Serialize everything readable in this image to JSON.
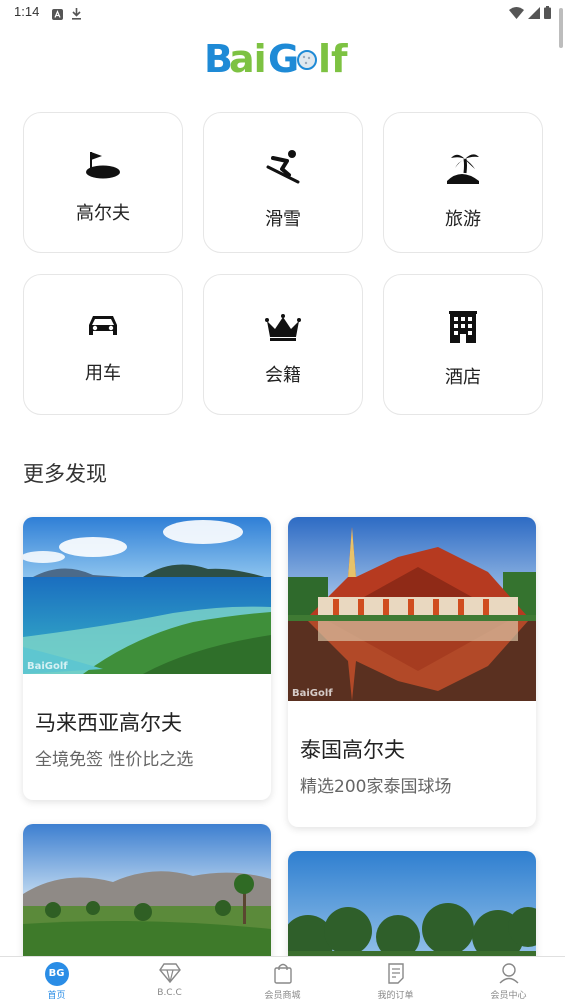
{
  "status": {
    "time": "1:14"
  },
  "logo": {
    "text": "BaiGolf"
  },
  "categories": [
    {
      "label": "高尔夫",
      "icon": "golf-green-icon"
    },
    {
      "label": "滑雪",
      "icon": "skier-icon"
    },
    {
      "label": "旅游",
      "icon": "palm-island-icon"
    },
    {
      "label": "用车",
      "icon": "car-icon"
    },
    {
      "label": "会籍",
      "icon": "crown-icon"
    },
    {
      "label": "酒店",
      "icon": "hotel-building-icon"
    }
  ],
  "section": {
    "title": "更多发现"
  },
  "cards": [
    {
      "title": "马来西亚高尔夫",
      "subtitle": "全境免签 性价比之选",
      "watermark": "BaiGolf"
    },
    {
      "title": "泰国高尔夫",
      "subtitle": "精选200家泰国球场",
      "watermark": "BaiGolf"
    }
  ],
  "tabs": [
    {
      "label": "首页",
      "badge": "BG",
      "icon": "home-badge-icon"
    },
    {
      "label": "B.C.C",
      "icon": "diamond-icon"
    },
    {
      "label": "会员商城",
      "icon": "shopping-bag-icon"
    },
    {
      "label": "我的订单",
      "icon": "order-list-icon"
    },
    {
      "label": "会员中心",
      "icon": "user-icon"
    }
  ],
  "colors": {
    "accent": "#2a8de6",
    "logo_blue": "#1e8ad6",
    "logo_green": "#7dc242"
  }
}
